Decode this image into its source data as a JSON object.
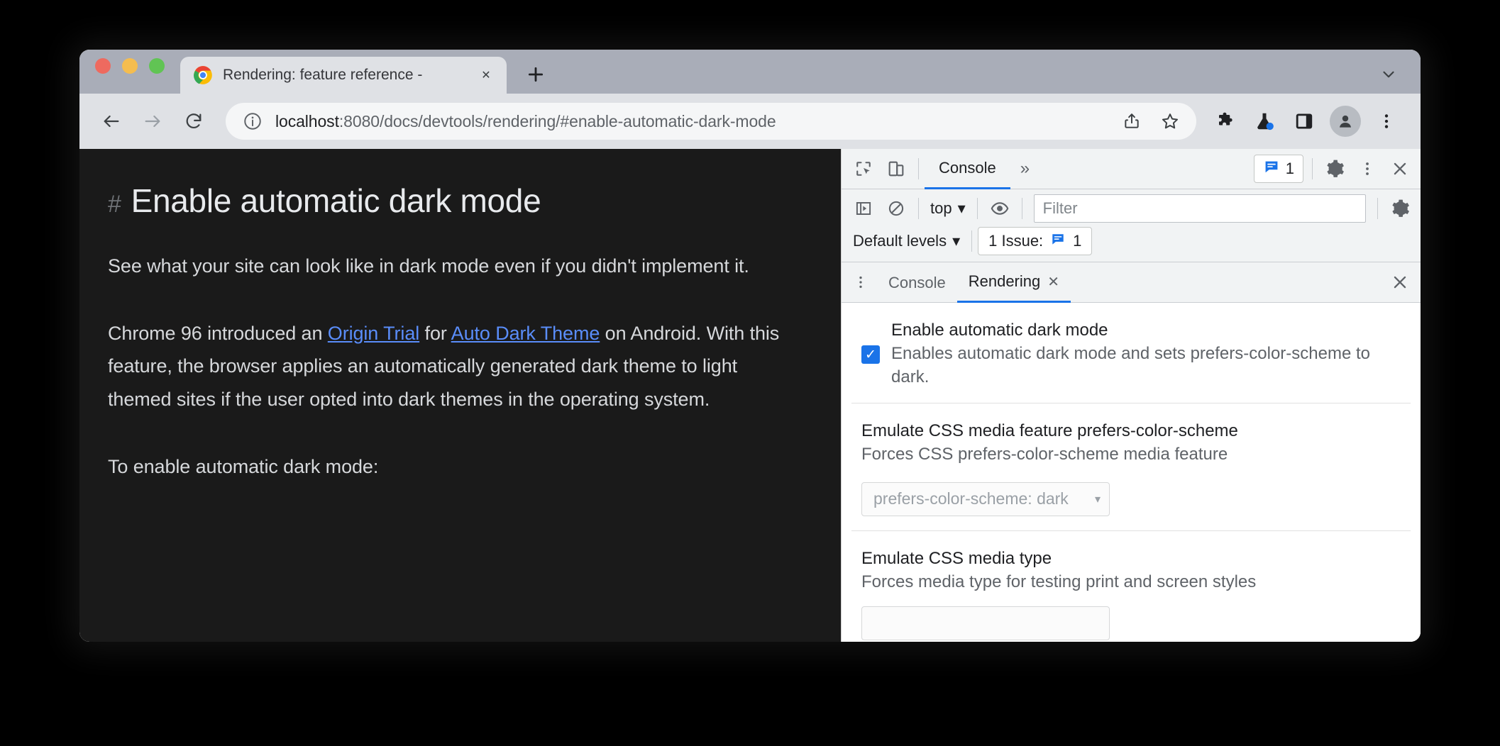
{
  "browser": {
    "tab": {
      "title": "Rendering: feature reference - ",
      "favicon": "chrome-logo-icon",
      "close_label": "✕"
    },
    "new_tab_label": "+",
    "window_chevron_label": "⌄",
    "toolbar": {
      "back_label": "←",
      "forward_label": "→",
      "reload_label": "⟳",
      "url_host": "localhost",
      "url_rest": ":8080/docs/devtools/rendering/#enable-automatic-dark-mode",
      "share_label": "share-icon",
      "bookmark_label": "star-icon",
      "extensions_label": "puzzle-icon",
      "experiments_label": "flask-icon",
      "side_panel_label": "side-panel-icon",
      "profile_label": "avatar-icon",
      "menu_label": "⋮"
    }
  },
  "page": {
    "anchor": "#",
    "heading": "Enable automatic dark mode",
    "paragraph1": "See what your site can look like in dark mode even if you didn't implement it.",
    "paragraph2_before": "Chrome 96 introduced an ",
    "paragraph2_link1": "Origin Trial",
    "paragraph2_mid": " for ",
    "paragraph2_link2": "Auto Dark Theme",
    "paragraph2_after": " on Android. With this feature, the browser applies an automatically generated dark theme to light themed sites if the user opted into dark themes in the operating system.",
    "paragraph3": "To enable automatic dark mode:"
  },
  "devtools": {
    "main_toolbar": {
      "inspect_label": "inspect-element-icon",
      "device_toolbar_label": "device-toolbar-icon",
      "panel_tab": "Console",
      "more_panels": "»",
      "issues_count": "1",
      "settings_label": "gear-icon",
      "more_label": "⋮",
      "close_label": "✕"
    },
    "console_toolbar": {
      "sidebar_toggle_label": "console-sidebar-icon",
      "clear_label": "clear-console-icon",
      "context": "top",
      "context_caret": "▾",
      "eye_label": "live-expression-icon",
      "filter_placeholder": "Filter",
      "filter_value": "",
      "settings_label": "gear-icon",
      "levels": "Default levels",
      "levels_caret": "▾",
      "issue_text": "1 Issue:",
      "issue_count": "1"
    },
    "drawer": {
      "menu_label": "⋮",
      "tabs": [
        {
          "label": "Console",
          "active": false,
          "closable": false
        },
        {
          "label": "Rendering",
          "active": true,
          "closable": true,
          "close_label": "✕"
        }
      ],
      "close_label": "✕"
    },
    "rendering": {
      "settings": [
        {
          "title": "Enable automatic dark mode",
          "description": "Enables automatic dark mode and sets prefers-color-scheme to dark.",
          "checked": true,
          "check_glyph": "✓"
        },
        {
          "title": "Emulate CSS media feature prefers-color-scheme",
          "description": "Forces CSS prefers-color-scheme media feature",
          "select_value": "prefers-color-scheme: dark",
          "select_caret": "▾"
        },
        {
          "title": "Emulate CSS media type",
          "description": "Forces media type for testing print and screen styles"
        }
      ]
    }
  },
  "colors": {
    "accent_blue": "#1a73e8",
    "link_blue": "#5a8dfa",
    "page_background": "#1a1a1a",
    "devtools_toolbar": "#f1f3f4",
    "tabstrip": "#a9adb8"
  }
}
